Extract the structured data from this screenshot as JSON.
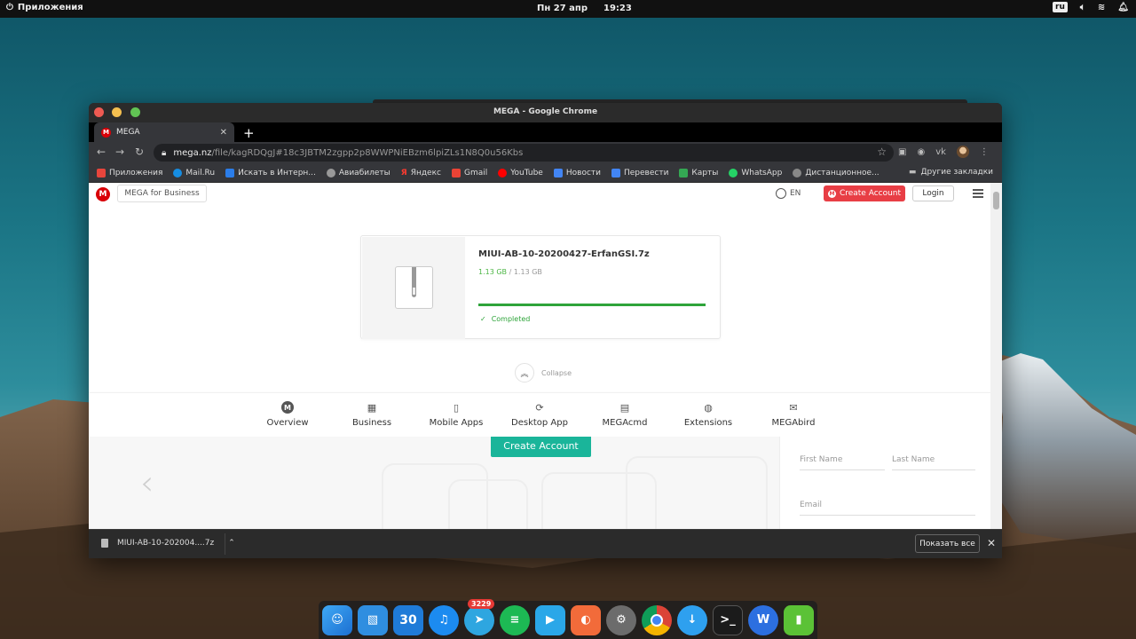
{
  "topbar": {
    "apps_label": "Приложения",
    "date": "Пн 27 апр",
    "time": "19:23",
    "keyboard_layout": "ru"
  },
  "window": {
    "title": "MEGA - Google Chrome"
  },
  "tab": {
    "title": "MEGA"
  },
  "toolbar": {
    "url_host": "mega.nz",
    "url_path": "/file/kagRDQgJ#18c3JBTM2zgpp2p8WWPNiEBzm6lpiZLs1N8Q0u56Kbs"
  },
  "bookmarks": {
    "items": [
      {
        "label": "Приложения",
        "color": "#e8453c"
      },
      {
        "label": "Mail.Ru",
        "color": "#168de2"
      },
      {
        "label": "Искать в Интерн...",
        "color": "#2b7de9"
      },
      {
        "label": "Авиабилеты",
        "color": "#999999"
      },
      {
        "label": "Яндекс",
        "color": "#ff0000"
      },
      {
        "label": "Gmail",
        "color": "#ea4335"
      },
      {
        "label": "YouTube",
        "color": "#ff0000"
      },
      {
        "label": "Новости",
        "color": "#4285f4"
      },
      {
        "label": "Перевести",
        "color": "#4285f4"
      },
      {
        "label": "Карты",
        "color": "#34a853"
      },
      {
        "label": "WhatsApp",
        "color": "#25d366"
      },
      {
        "label": "Дистанционное...",
        "color": "#888888"
      }
    ],
    "other": "Другие закладки"
  },
  "mega": {
    "business_button": "MEGA for Business",
    "language": "EN",
    "create_account": "Create Account",
    "login": "Login",
    "file_name": "MIUI-AB-10-20200427-ErfanGSI.7z",
    "downloaded": "1.13 GB",
    "separator": "/",
    "total": "1.13 GB",
    "progress_percent": 100,
    "status": "Completed",
    "collapse": "Collapse",
    "features": [
      {
        "label": "Overview",
        "icon": "mega-circle-icon"
      },
      {
        "label": "Business",
        "icon": "building-icon"
      },
      {
        "label": "Mobile Apps",
        "icon": "phone-icon"
      },
      {
        "label": "Desktop App",
        "icon": "sync-icon"
      },
      {
        "label": "MEGAcmd",
        "icon": "terminal-icon"
      },
      {
        "label": "Extensions",
        "icon": "globe-icon"
      },
      {
        "label": "MEGAbird",
        "icon": "envelope-icon"
      }
    ],
    "create_account_green": "Create Account",
    "form": {
      "first_name": "First Name",
      "last_name": "Last Name",
      "email": "Email"
    }
  },
  "downloads": {
    "file": "MIUI-AB-10-202004....7z",
    "show_all": "Показать все"
  },
  "dock": {
    "badge_count": "3229",
    "calendar_day": "30"
  },
  "colors": {
    "mega_red": "#d90007",
    "success_green": "#2ea43a",
    "teal_button": "#1ab59a"
  }
}
